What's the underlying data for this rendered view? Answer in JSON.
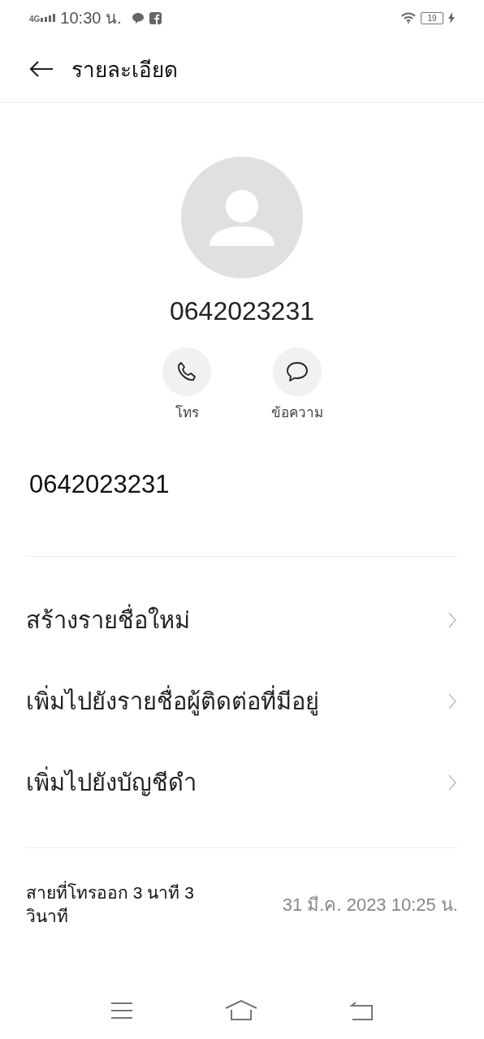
{
  "status_bar": {
    "network": "4G",
    "time": "10:30 น.",
    "battery": "19"
  },
  "header": {
    "title": "รายละเอียด"
  },
  "contact": {
    "name": "0642023231"
  },
  "actions": [
    {
      "kind": "call",
      "label": "โทร"
    },
    {
      "kind": "message",
      "label": "ข้อความ"
    }
  ],
  "number": "0642023231",
  "menu": [
    {
      "label": "สร้างรายชื่อใหม่"
    },
    {
      "label": "เพิ่มไปยังรายชื่อผู้ติดต่อที่มีอยู่"
    },
    {
      "label": "เพิ่มไปยังบัญชีดำ"
    }
  ],
  "call_log": [
    {
      "description": "สายที่โทรออก 3 นาที 3 วินาที",
      "time": "31 มี.ค. 2023 10:25 น."
    }
  ]
}
